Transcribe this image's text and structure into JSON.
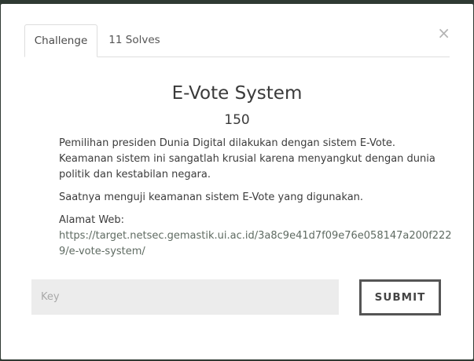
{
  "modal": {
    "close_glyph": "×",
    "tabs": [
      {
        "label": "Challenge",
        "active": true
      },
      {
        "label": "11 Solves",
        "active": false
      }
    ],
    "title": "E-Vote System",
    "points": "150",
    "description": {
      "paragraph1": "Pemilihan presiden Dunia Digital dilakukan dengan sistem E-Vote. Keamanan sistem ini sangatlah krusial karena menyangkut dengan dunia politik dan kestabilan negara.",
      "paragraph2": "Saatnya menguji keamanan sistem E-Vote yang digunakan.",
      "address_label": "Alamat Web:",
      "address_url": "https://target.netsec.gemastik.ui.ac.id/3a8c9e41d7f09e76e058147a200f2229/e-vote-system/"
    },
    "key_input": {
      "placeholder": "Key",
      "value": ""
    },
    "submit_label": "SUBMIT"
  }
}
